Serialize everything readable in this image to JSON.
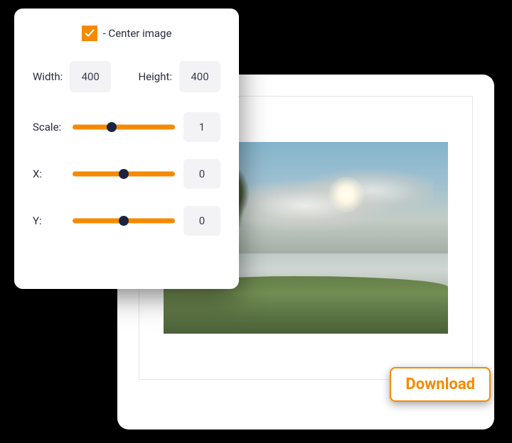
{
  "controls": {
    "center_image": {
      "checked": true,
      "label": "- Center image"
    },
    "width": {
      "label": "Width:",
      "value": "400"
    },
    "height": {
      "label": "Height:",
      "value": "400"
    },
    "scale": {
      "label": "Scale:",
      "value": "1",
      "thumb_pct": 38
    },
    "x": {
      "label": "X:",
      "value": "0",
      "thumb_pct": 50
    },
    "y": {
      "label": "Y:",
      "value": "0",
      "thumb_pct": 50
    }
  },
  "actions": {
    "download_label": "Download"
  },
  "colors": {
    "accent": "#f58a00",
    "thumb": "#1a2440",
    "input_bg": "#f3f3f5",
    "text": "#2a2d3e"
  }
}
